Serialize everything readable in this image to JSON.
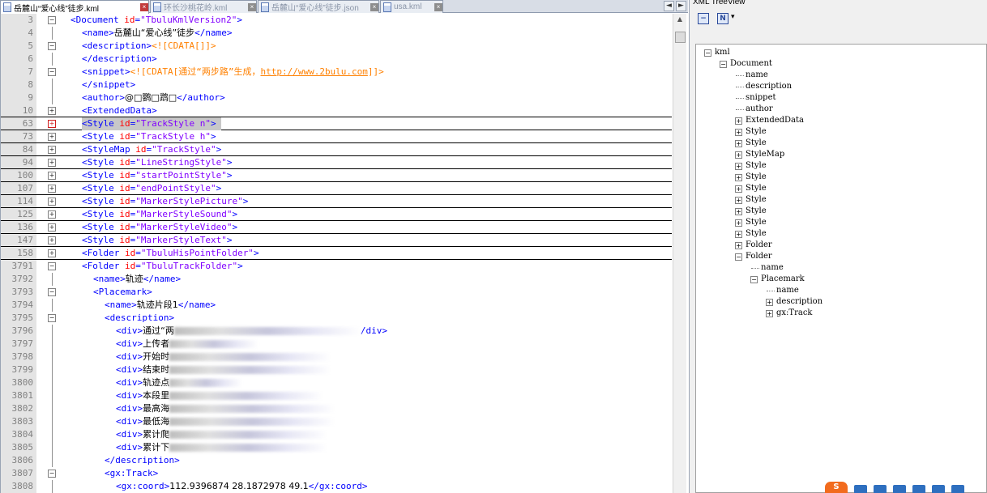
{
  "tabs": [
    {
      "label": "岳麓山“爱心线”徒步.kml",
      "active": true
    },
    {
      "label": "环长沙桃花岭.kml",
      "active": false
    },
    {
      "label": "岳麓山“爱心线”徒步.json",
      "active": false
    },
    {
      "label": "usa.kml",
      "active": false
    }
  ],
  "nav": {
    "prev": "◄",
    "next": "►"
  },
  "editor_lines": [
    {
      "ln": "3",
      "fold": "minus",
      "html": "<span class=\"tag\">&lt;Document </span><span class=\"attr\">id</span><span class=\"tag\">=</span><span class=\"val\">\"TbuluKmlVersion2\"</span><span class=\"tag\">&gt;</span>",
      "indent": 0
    },
    {
      "ln": "4",
      "fold": "",
      "indent": 1,
      "html": "<span class=\"tag\">&lt;name&gt;</span><span class=\"txt\">岳麓山“爱心线”徒步</span><span class=\"tag\">&lt;/name&gt;</span>"
    },
    {
      "ln": "5",
      "fold": "minus",
      "indent": 1,
      "html": "<span class=\"tag\">&lt;description&gt;</span><span class=\"cdata\">&lt;![CDATA[]]&gt;</span>"
    },
    {
      "ln": "6",
      "fold": "",
      "indent": 1,
      "html": "<span class=\"tag\">&lt;/description&gt;</span>"
    },
    {
      "ln": "7",
      "fold": "minus",
      "indent": 1,
      "html": "<span class=\"tag\">&lt;snippet&gt;</span><span class=\"cdata\">&lt;![CDATA[通过“两步路”生成，</span><span class=\"url\">http://www.2bulu.com</span><span class=\"cdata\">]]&gt;</span>"
    },
    {
      "ln": "8",
      "fold": "",
      "indent": 1,
      "html": "<span class=\"tag\">&lt;/snippet&gt;</span>"
    },
    {
      "ln": "9",
      "fold": "",
      "indent": 1,
      "html": "<span class=\"tag\">&lt;author&gt;</span><span class=\"txt\">@□鹦□鹉□</span><span class=\"tag\">&lt;/author&gt;</span>"
    },
    {
      "ln": "10",
      "fold": "plus",
      "indent": 1,
      "boxed": true,
      "html": "<span class=\"tag\">&lt;ExtendedData&gt;</span>"
    },
    {
      "ln": "63",
      "fold": "plus-red",
      "indent": 1,
      "boxed": true,
      "sel": true,
      "html": "<span class=\"tag\">&lt;Style </span><span class=\"attr\">id</span><span class=\"tag\">=</span><span class=\"val\">\"TrackStyle n\"</span><span class=\"tag\">&gt; </span>"
    },
    {
      "ln": "73",
      "fold": "plus",
      "indent": 1,
      "boxed": true,
      "html": "<span class=\"tag\">&lt;Style </span><span class=\"attr\">id</span><span class=\"tag\">=</span><span class=\"val\">\"TrackStyle h\"</span><span class=\"tag\">&gt;</span>"
    },
    {
      "ln": "84",
      "fold": "plus",
      "indent": 1,
      "boxed": true,
      "html": "<span class=\"tag\">&lt;StyleMap </span><span class=\"attr\">id</span><span class=\"tag\">=</span><span class=\"val\">\"TrackStyle\"</span><span class=\"tag\">&gt;</span>"
    },
    {
      "ln": "94",
      "fold": "plus",
      "indent": 1,
      "boxed": true,
      "html": "<span class=\"tag\">&lt;Style </span><span class=\"attr\">id</span><span class=\"tag\">=</span><span class=\"val\">\"LineStringStyle\"</span><span class=\"tag\">&gt;</span>"
    },
    {
      "ln": "100",
      "fold": "plus",
      "indent": 1,
      "boxed": true,
      "html": "<span class=\"tag\">&lt;Style </span><span class=\"attr\">id</span><span class=\"tag\">=</span><span class=\"val\">\"startPointStyle\"</span><span class=\"tag\">&gt;</span>"
    },
    {
      "ln": "107",
      "fold": "plus",
      "indent": 1,
      "boxed": true,
      "html": "<span class=\"tag\">&lt;Style </span><span class=\"attr\">id</span><span class=\"tag\">=</span><span class=\"val\">\"endPointStyle\"</span><span class=\"tag\">&gt;</span>"
    },
    {
      "ln": "114",
      "fold": "plus",
      "indent": 1,
      "boxed": true,
      "html": "<span class=\"tag\">&lt;Style </span><span class=\"attr\">id</span><span class=\"tag\">=</span><span class=\"val\">\"MarkerStylePicture\"</span><span class=\"tag\">&gt;</span>"
    },
    {
      "ln": "125",
      "fold": "plus",
      "indent": 1,
      "boxed": true,
      "html": "<span class=\"tag\">&lt;Style </span><span class=\"attr\">id</span><span class=\"tag\">=</span><span class=\"val\">\"MarkerStyleSound\"</span><span class=\"tag\">&gt;</span>"
    },
    {
      "ln": "136",
      "fold": "plus",
      "indent": 1,
      "boxed": true,
      "html": "<span class=\"tag\">&lt;Style </span><span class=\"attr\">id</span><span class=\"tag\">=</span><span class=\"val\">\"MarkerStyleVideo\"</span><span class=\"tag\">&gt;</span>"
    },
    {
      "ln": "147",
      "fold": "plus",
      "indent": 1,
      "boxed": true,
      "html": "<span class=\"tag\">&lt;Style </span><span class=\"attr\">id</span><span class=\"tag\">=</span><span class=\"val\">\"MarkerStyleText\"</span><span class=\"tag\">&gt;</span>"
    },
    {
      "ln": "158",
      "fold": "plus",
      "indent": 1,
      "boxed": true,
      "html": "<span class=\"tag\">&lt;Folder </span><span class=\"attr\">id</span><span class=\"tag\">=</span><span class=\"val\">\"TbuluHisPointFolder\"</span><span class=\"tag\">&gt;</span>"
    },
    {
      "ln": "3791",
      "fold": "minus",
      "indent": 1,
      "html": "<span class=\"tag\">&lt;Folder </span><span class=\"attr\">id</span><span class=\"tag\">=</span><span class=\"val\">\"TbuluTrackFolder\"</span><span class=\"tag\">&gt;</span>"
    },
    {
      "ln": "3792",
      "fold": "",
      "indent": 2,
      "html": "<span class=\"tag\">&lt;name&gt;</span><span class=\"txt\">轨迹</span><span class=\"tag\">&lt;/name&gt;</span>"
    },
    {
      "ln": "3793",
      "fold": "minus",
      "indent": 2,
      "html": "<span class=\"tag\">&lt;Placemark&gt;</span>"
    },
    {
      "ln": "3794",
      "fold": "",
      "indent": 3,
      "html": "<span class=\"tag\">&lt;name&gt;</span><span class=\"txt\">轨迹片段1</span><span class=\"tag\">&lt;/name&gt;</span>"
    },
    {
      "ln": "3795",
      "fold": "minus",
      "indent": 3,
      "html": "<span class=\"tag\">&lt;description&gt;</span>"
    },
    {
      "ln": "3796",
      "fold": "",
      "indent": 4,
      "html": "<span class=\"tag\">&lt;div&gt;</span><span class=\"txt\">通过“两</span><span class=\"blur\" style=\"width:230px\"></span><span class=\"tag\">/div&gt;</span>"
    },
    {
      "ln": "3797",
      "fold": "",
      "indent": 4,
      "html": "<span class=\"tag\">&lt;div&gt;</span><span class=\"txt\">上传者</span><span class=\"blur\" style=\"width:110px\"></span>"
    },
    {
      "ln": "3798",
      "fold": "",
      "indent": 4,
      "html": "<span class=\"tag\">&lt;div&gt;</span><span class=\"txt\">开始时</span><span class=\"blur\" style=\"width:200px\"></span>"
    },
    {
      "ln": "3799",
      "fold": "",
      "indent": 4,
      "html": "<span class=\"tag\">&lt;div&gt;</span><span class=\"txt\">结束时</span><span class=\"blur\" style=\"width:200px\"></span>"
    },
    {
      "ln": "3800",
      "fold": "",
      "indent": 4,
      "html": "<span class=\"tag\">&lt;div&gt;</span><span class=\"txt\">轨迹点</span><span class=\"blur\" style=\"width:90px\"></span>"
    },
    {
      "ln": "3801",
      "fold": "",
      "indent": 4,
      "html": "<span class=\"tag\">&lt;div&gt;</span><span class=\"txt\">本段里</span><span class=\"blur\" style=\"width:190px\"></span>"
    },
    {
      "ln": "3802",
      "fold": "",
      "indent": 4,
      "html": "<span class=\"tag\">&lt;div&gt;</span><span class=\"txt\">最高海</span><span class=\"blur\" style=\"width:205px\"></span>"
    },
    {
      "ln": "3803",
      "fold": "",
      "indent": 4,
      "html": "<span class=\"tag\">&lt;div&gt;</span><span class=\"txt\">最低海</span><span class=\"blur\" style=\"width:205px\"></span>"
    },
    {
      "ln": "3804",
      "fold": "",
      "indent": 4,
      "html": "<span class=\"tag\">&lt;div&gt;</span><span class=\"txt\">累计爬</span><span class=\"blur\" style=\"width:195px\"></span>"
    },
    {
      "ln": "3805",
      "fold": "",
      "indent": 4,
      "html": "<span class=\"tag\">&lt;div&gt;</span><span class=\"txt\">累计下</span><span class=\"blur\" style=\"width:195px\"></span>"
    },
    {
      "ln": "3806",
      "fold": "",
      "indent": 3,
      "html": "<span class=\"tag\">&lt;/description&gt;</span>"
    },
    {
      "ln": "3807",
      "fold": "minus",
      "indent": 3,
      "html": "<span class=\"tag\">&lt;gx:Track&gt;</span>"
    },
    {
      "ln": "3808",
      "fold": "",
      "indent": 4,
      "html": "<span class=\"tag\">&lt;gx:coord&gt;</span><span class=\"txt\">112.9396874 28.1872978 49.1</span><span class=\"tag\">&lt;/gx:coord&gt;</span>"
    }
  ],
  "panel": {
    "title": "XML TreeView",
    "btn_collapse": "−",
    "btn_node": "N",
    "btn_dropdown": "▾"
  },
  "tree": [
    {
      "label": "kml",
      "depth": 0,
      "exp": "minus"
    },
    {
      "label": "Document",
      "depth": 1,
      "exp": "minus"
    },
    {
      "label": "name",
      "depth": 2,
      "exp": ""
    },
    {
      "label": "description",
      "depth": 2,
      "exp": ""
    },
    {
      "label": "snippet",
      "depth": 2,
      "exp": ""
    },
    {
      "label": "author",
      "depth": 2,
      "exp": ""
    },
    {
      "label": "ExtendedData",
      "depth": 2,
      "exp": "plus"
    },
    {
      "label": "Style",
      "depth": 2,
      "exp": "plus"
    },
    {
      "label": "Style",
      "depth": 2,
      "exp": "plus"
    },
    {
      "label": "StyleMap",
      "depth": 2,
      "exp": "plus"
    },
    {
      "label": "Style",
      "depth": 2,
      "exp": "plus"
    },
    {
      "label": "Style",
      "depth": 2,
      "exp": "plus"
    },
    {
      "label": "Style",
      "depth": 2,
      "exp": "plus"
    },
    {
      "label": "Style",
      "depth": 2,
      "exp": "plus"
    },
    {
      "label": "Style",
      "depth": 2,
      "exp": "plus"
    },
    {
      "label": "Style",
      "depth": 2,
      "exp": "plus"
    },
    {
      "label": "Style",
      "depth": 2,
      "exp": "plus"
    },
    {
      "label": "Folder",
      "depth": 2,
      "exp": "plus"
    },
    {
      "label": "Folder",
      "depth": 2,
      "exp": "minus"
    },
    {
      "label": "name",
      "depth": 3,
      "exp": ""
    },
    {
      "label": "Placemark",
      "depth": 3,
      "exp": "minus"
    },
    {
      "label": "name",
      "depth": 4,
      "exp": ""
    },
    {
      "label": "description",
      "depth": 4,
      "exp": "plus"
    },
    {
      "label": "gx:Track",
      "depth": 4,
      "exp": "plus"
    }
  ],
  "ime": {
    "logo": "S"
  }
}
